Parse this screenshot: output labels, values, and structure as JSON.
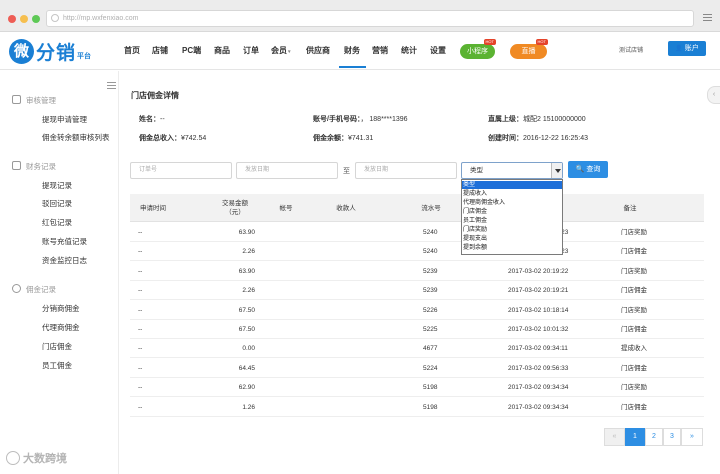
{
  "browser": {
    "url": "http://mp.wxfenxiao.com",
    "traffic_colors": [
      "#ee5d55",
      "#f6bf4f",
      "#5ec956"
    ]
  },
  "brand": {
    "logo_mark": "微",
    "name": "分销",
    "sub": "平台",
    "color": "#1a7fd4"
  },
  "nav": {
    "items": [
      "首页",
      "店铺",
      "PC端",
      "商品",
      "订单",
      "会员",
      "供应商",
      "财务",
      "营销",
      "统计",
      "设置"
    ],
    "active": "财务",
    "mini_program": "小程序",
    "live": "直播",
    "hot_badge": "HOT",
    "user_name": "测试店铺",
    "account_button": "账户"
  },
  "sidebar": {
    "sections": [
      {
        "title": "审核管理",
        "items": [
          "提现申请管理",
          "佣金转余额审核列表"
        ]
      },
      {
        "title": "财务记录",
        "items": [
          "提现记录",
          "驳回记录",
          "红包记录",
          "账号充值记录",
          "资金监控日志"
        ]
      },
      {
        "title": "佣金记录",
        "items": [
          "分销商佣金",
          "代理商佣金",
          "门店佣金",
          "员工佣金"
        ]
      }
    ]
  },
  "page": {
    "title": "门店佣金详情",
    "name_label": "姓名：",
    "name_value": "--",
    "account_label": "账号/手机号码：",
    "account_value": "，  188****1396",
    "parent_label": "直属上级：",
    "parent_value": "城配2  15100000000",
    "total_income_label": "佣金总收入：",
    "total_income_value": "¥742.54",
    "balance_label": "佣金余额：",
    "balance_value": "¥741.31",
    "created_label": "创建时间：",
    "created_value": "2016-12-22 16:25:43"
  },
  "filters": {
    "order_placeholder": "订单号",
    "start_placeholder": "发放日期",
    "to_label": "至",
    "end_placeholder": "发放日期",
    "type_value": "类型",
    "query_button": "查询"
  },
  "type_options": [
    "类型",
    "提成收入",
    "代理商佣金收入",
    "门店佣金",
    "员工佣金",
    "门店奖励",
    "提现支出",
    "提到余额"
  ],
  "table": {
    "headers": [
      "申请时间",
      "交易金额\n（元）",
      "帐号",
      "收款人",
      "流水号",
      "",
      "备注"
    ],
    "rows": [
      {
        "apply": "--",
        "amount": "63.90",
        "serial": "5240",
        "time": "2017-03-02 20:19:23",
        "note": "门店奖励"
      },
      {
        "apply": "--",
        "amount": "2.26",
        "serial": "5240",
        "time": "2017-03-02 20:19:23",
        "note": "门店佣金"
      },
      {
        "apply": "--",
        "amount": "63.90",
        "serial": "5239",
        "time": "2017-03-02 20:19:22",
        "note": "门店奖励"
      },
      {
        "apply": "--",
        "amount": "2.26",
        "serial": "5239",
        "time": "2017-03-02 20:19:21",
        "note": "门店佣金"
      },
      {
        "apply": "--",
        "amount": "67.50",
        "serial": "5226",
        "time": "2017-03-02 10:18:14",
        "note": "门店奖励"
      },
      {
        "apply": "--",
        "amount": "67.50",
        "serial": "5225",
        "time": "2017-03-02 10:01:32",
        "note": "门店佣金"
      },
      {
        "apply": "--",
        "amount": "0.00",
        "serial": "4677",
        "time": "2017-03-02 09:34:11",
        "note": "提成收入"
      },
      {
        "apply": "--",
        "amount": "64.45",
        "serial": "5224",
        "time": "2017-03-02 09:56:33",
        "note": "门店佣金"
      },
      {
        "apply": "--",
        "amount": "62.90",
        "serial": "5198",
        "time": "2017-03-02 09:34:34",
        "note": "门店奖励"
      },
      {
        "apply": "--",
        "amount": "1.26",
        "serial": "5198",
        "time": "2017-03-02 09:34:34",
        "note": "门店佣金"
      }
    ]
  },
  "pagination": {
    "prev": "«",
    "pages": [
      "1",
      "2",
      "3"
    ],
    "current": "1",
    "next": "»"
  },
  "watermark": "大数跨境",
  "colors": {
    "primary": "#2d8ee3",
    "green_pill": "#5bb332",
    "orange_pill": "#f08a24"
  }
}
